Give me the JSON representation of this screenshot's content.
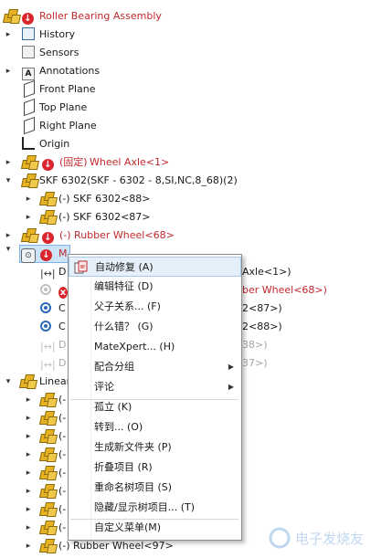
{
  "tree": {
    "root": {
      "label": "Roller Bearing Assembly"
    },
    "history": "History",
    "sensors": "Sensors",
    "annotations": "Annotations",
    "front_plane": "Front Plane",
    "top_plane": "Top Plane",
    "right_plane": "Right Plane",
    "origin": "Origin",
    "axle": {
      "prefix": "(固定)",
      "name": "Wheel Axle<1>"
    },
    "skf": {
      "label": "SKF 6302(SKF - 6302 - 8,SI,NC,8_68)(2)"
    },
    "skf_88": "(-) SKF 6302<88>",
    "skf_87": "(-) SKF 6302<87>",
    "rubber_68": "(-) Rubber Wheel<68>",
    "mates": {
      "label": "M"
    },
    "mate_rows": [
      {
        "lead": "D",
        "tail": "Axle<1>)"
      },
      {
        "lead": "",
        "tail": "ber Wheel<68>)"
      },
      {
        "lead": "C",
        "tail": "2<87>)"
      },
      {
        "lead": "C",
        "tail": "2<88>)"
      },
      {
        "lead": "D",
        "tail": "38>)"
      },
      {
        "lead": "D",
        "tail": "37>)"
      }
    ],
    "linear": "Linear",
    "linear_children": [
      "(-",
      "(-",
      "(-",
      "(-",
      "(-",
      "(-",
      "(-",
      "(-"
    ],
    "last": "(-) Rubber Wheel<97>"
  },
  "menu": {
    "items": [
      {
        "label": "自动修复 (A)"
      },
      {
        "label": "编辑特征 (D)"
      },
      {
        "label": "父子关系... (F)"
      },
      {
        "label": "什么错？ (G)"
      },
      {
        "label": "MateXpert... (H)"
      },
      {
        "label": "配合分组"
      },
      {
        "label": "评论"
      },
      {
        "label": "孤立 (K)"
      },
      {
        "label": "转到... (O)"
      },
      {
        "label": "生成新文件夹 (P)"
      },
      {
        "label": "折叠项目 (R)"
      },
      {
        "label": "重命名树项目 (S)"
      },
      {
        "label": "隐藏/显示树项目... (T)"
      },
      {
        "label": "自定义菜单(M)"
      }
    ]
  },
  "watermark": "电子发烧友",
  "colors": {
    "error_red": "#d9262c",
    "error_text": "#c0282d",
    "selection": "#cde3f7",
    "radio_blue": "#2b6cb8"
  }
}
